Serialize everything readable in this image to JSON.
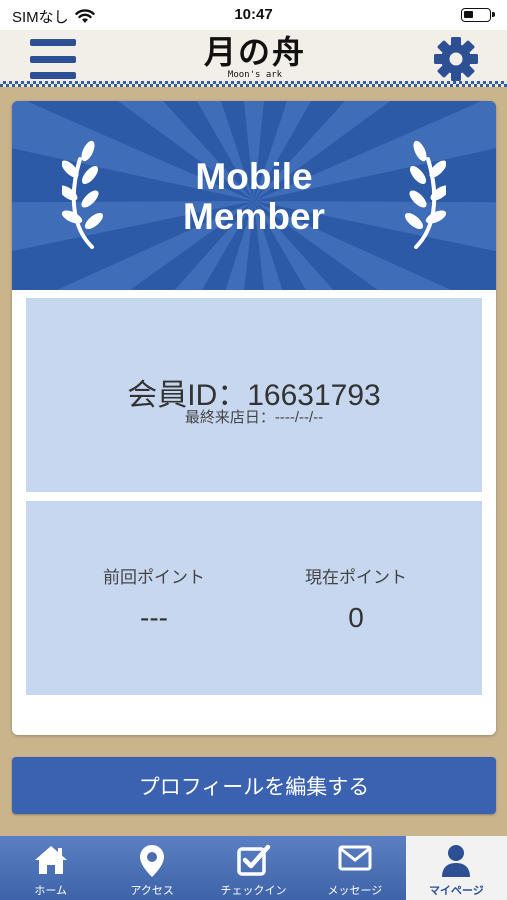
{
  "status_bar": {
    "carrier": "SIMなし",
    "time": "10:47"
  },
  "header": {
    "logo_main": "月の舟",
    "logo_sub": "Moon's ark"
  },
  "card": {
    "banner_line1": "Mobile",
    "banner_line2": "Member",
    "member_id": "会員ID：16631793",
    "last_visit": "最終来店日：----/--/--",
    "previous_points_label": "前回ポイント",
    "previous_points_value": "---",
    "current_points_label": "現在ポイント",
    "current_points_value": "0"
  },
  "edit_profile_label": "プロフィールを編集する",
  "tabs": [
    {
      "label": "ホーム",
      "icon": "home-icon"
    },
    {
      "label": "アクセス",
      "icon": "map-pin-icon"
    },
    {
      "label": "チェックイン",
      "icon": "checkbox-icon"
    },
    {
      "label": "メッセージ",
      "icon": "envelope-icon"
    },
    {
      "label": "マイページ",
      "icon": "user-icon"
    }
  ],
  "colors": {
    "brand_blue": "#3a62b0",
    "panel_light_blue": "#c7d7ef",
    "banner_blue": "#2d5aa6",
    "background_tan": "#c9b48c"
  }
}
